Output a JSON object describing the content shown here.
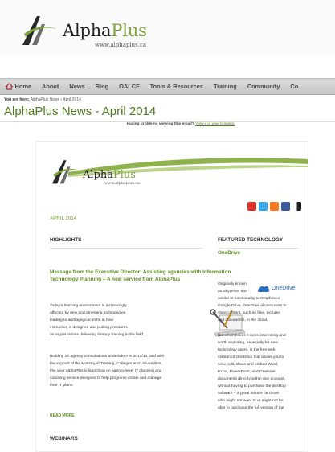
{
  "site": {
    "logo_alpha": "Alpha",
    "logo_plus": "Plus",
    "logo_url": "www.alphaplus.ca"
  },
  "nav": {
    "items": [
      "Home",
      "About",
      "News",
      "Blog",
      "OALCF",
      "Tools & Resources",
      "Training",
      "Community",
      "Co"
    ]
  },
  "breadcrumb": {
    "prefix": "You are here:",
    "links": "AlphaPlus News › April 2014"
  },
  "page": {
    "title": "AlphaPlus News - April 2014",
    "viewing_text": "Having problems viewing this email?",
    "viewing_link": "View it in your browser."
  },
  "newsletter": {
    "logo_alpha": "Alpha",
    "logo_plus": "Plus",
    "logo_url": "www.alphaplus.ca",
    "date": "APRIL 2014",
    "highlights_heading": "HIGHLIGHTS",
    "featured_heading": "FEATURED TECHNOLOGY",
    "article": {
      "title": "Message from the Executive Director: Assisting agencies with Information Technology Planning – A new service from AlphaPlus",
      "para1": [
        "Today's learning environment is increasingly",
        "affected by new and emerging technologies,",
        "leading to andragogical shifts in how",
        "instruction is designed and putting pressures",
        "on organizations delivering literacy training in the field."
      ],
      "para2": [
        "Building on agency consultations undertaken in 2013/14, and with",
        "the support of the Ministry of Training, Colleges and Universities,",
        "this year AlphaPlus is launching an agency-level IT planning and",
        "coaching service designed to help programs create and manage",
        "their IT plans."
      ],
      "read_more": "READ MORE"
    },
    "webinars_heading": "WEBINARS",
    "onedrive": {
      "title": "OneDrive",
      "logo_text": "OneDrive",
      "para1": [
        "Originally known",
        "as SkyDrive, and",
        "similar in functionality to Dropbox or",
        "Google Drive, OneDrive allows users to",
        "store content, such as files, pictures",
        "and documents, in the cloud."
      ],
      "para2": [
        "But what makes it more interesting and",
        "worth exploring, especially for new",
        "technology users, is the free web",
        "version of OneDrive that allows you to",
        "view, edit, share and embed Word,",
        "Excel, PowerPoint, and OneNote",
        "documents directly within one account,",
        "without having to purchase the desktop",
        "software – a great feature for those",
        "who might not want to or might not be",
        "able to purchase the full version of the"
      ]
    }
  },
  "colors": {
    "accent_green": "#5e8e22",
    "title_green": "#4f7a1e",
    "logo_plus_green": "#7aa33a",
    "nav_bg": "#d0d0d0",
    "onedrive_blue": "#2a6fc0"
  }
}
